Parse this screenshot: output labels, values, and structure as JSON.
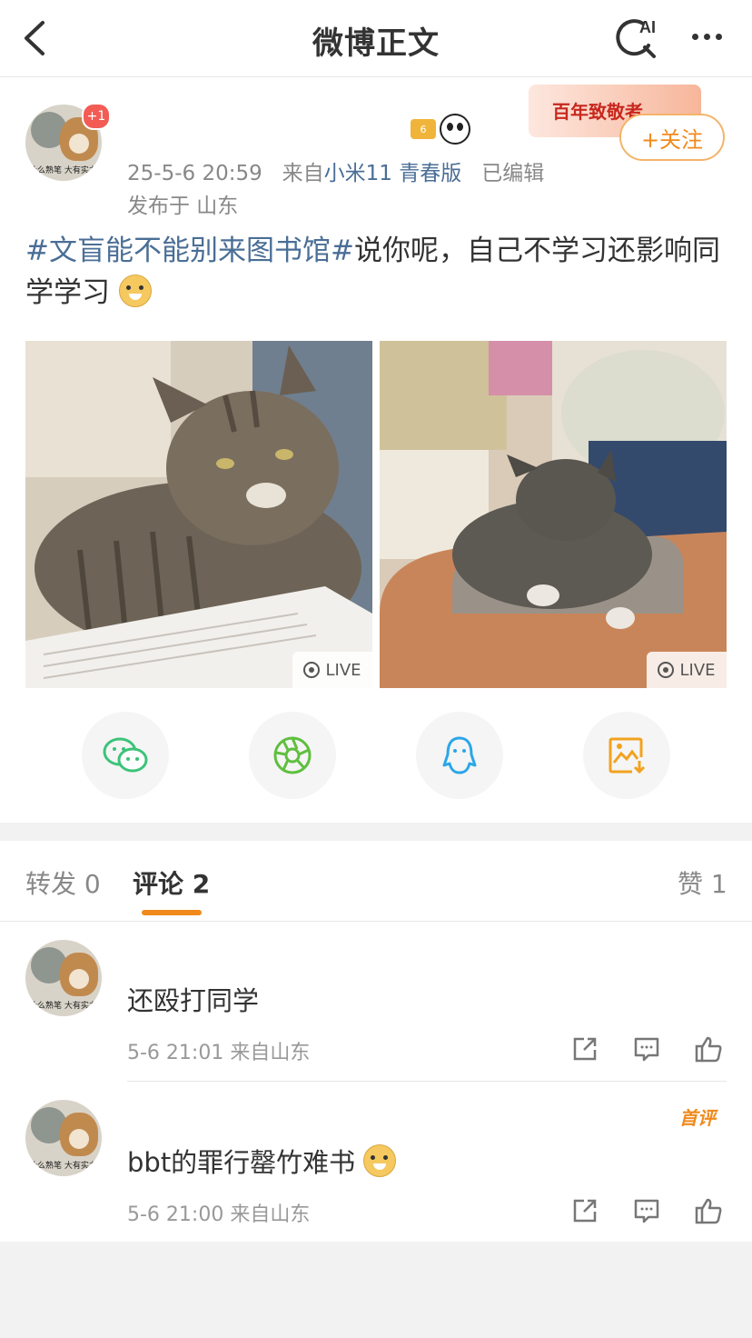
{
  "nav": {
    "title": "微博正文",
    "ai_label": "AI"
  },
  "post": {
    "badge": "+1",
    "vip_level": "6",
    "promo_text": "百年致敬者",
    "follow_label": "+关注",
    "time": "25-5-6 20:59",
    "from_prefix": "来自",
    "device": "小米11 青春版",
    "edited": "已编辑",
    "location": "发布于 山东",
    "avatar_caption": "什么熟笔 大有实力",
    "topic": "#文盲能不能别来图书馆#",
    "text": "说你呢，自己不学习还影响同学学习",
    "images": [
      {
        "live_label": "LIVE"
      },
      {
        "live_label": "LIVE"
      }
    ]
  },
  "share": {
    "items": [
      "wechat-icon",
      "moments-icon",
      "qq-icon",
      "save-image-icon"
    ],
    "colors": {
      "wechat": "#3cc37a",
      "moments": "#5fbf3e",
      "qq": "#2aa7e8",
      "save": "#f2a21f"
    }
  },
  "tabs": {
    "repost": "转发 0",
    "comments": "评论 2",
    "likes": "赞 1"
  },
  "comments": [
    {
      "text": "还殴打同学",
      "time": "5-6 21:01 来自山东"
    },
    {
      "text": "bbt的罪行罄竹难书",
      "time": "5-6 21:00 来自山东",
      "tag": "首评"
    }
  ],
  "colors": {
    "accent": "#f08a1c",
    "link": "#4a6e96"
  }
}
